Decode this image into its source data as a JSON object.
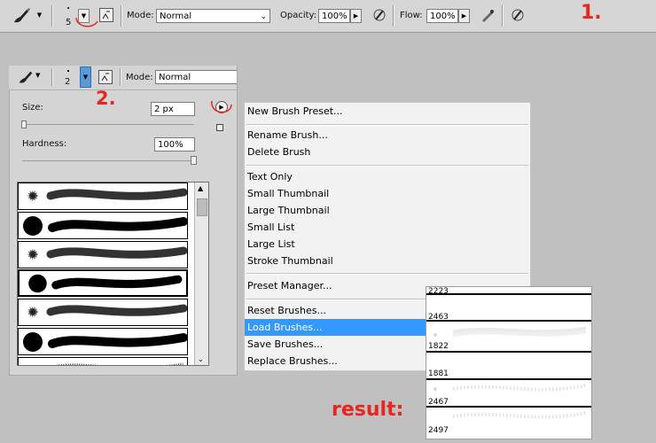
{
  "toolbar": {
    "brush_size": "5",
    "mode_label": "Mode:",
    "mode_value": "Normal",
    "opacity_label": "Opacity:",
    "opacity_value": "100%",
    "flow_label": "Flow:",
    "flow_value": "100%",
    "annotation": "1."
  },
  "panel": {
    "brush_size": "2",
    "mode_label": "Mode:",
    "mode_value": "Normal",
    "annotation": "2.",
    "size_label": "Size:",
    "size_value": "2 px",
    "hardness_label": "Hardness:",
    "hardness_value": "100%",
    "size_slider": 0.0,
    "hardness_slider": 1.0
  },
  "menu": {
    "groups": [
      [
        "New Brush Preset..."
      ],
      [
        "Rename Brush...",
        "Delete Brush"
      ],
      [
        "Text Only",
        "Small Thumbnail",
        "Large Thumbnail",
        "Small List",
        "Large List",
        "Stroke Thumbnail"
      ],
      [
        "Preset Manager..."
      ],
      [
        "Reset Brushes...",
        "Load Brushes...",
        "Save Brushes...",
        "Replace Brushes..."
      ]
    ],
    "highlighted": "Load Brushes..."
  },
  "result": {
    "label": "result:",
    "items": [
      "2223",
      "2463",
      "1822",
      "1881",
      "2467",
      "2497"
    ]
  },
  "colors": {
    "annotation": "#e8261e",
    "highlight": "#3399ff"
  }
}
